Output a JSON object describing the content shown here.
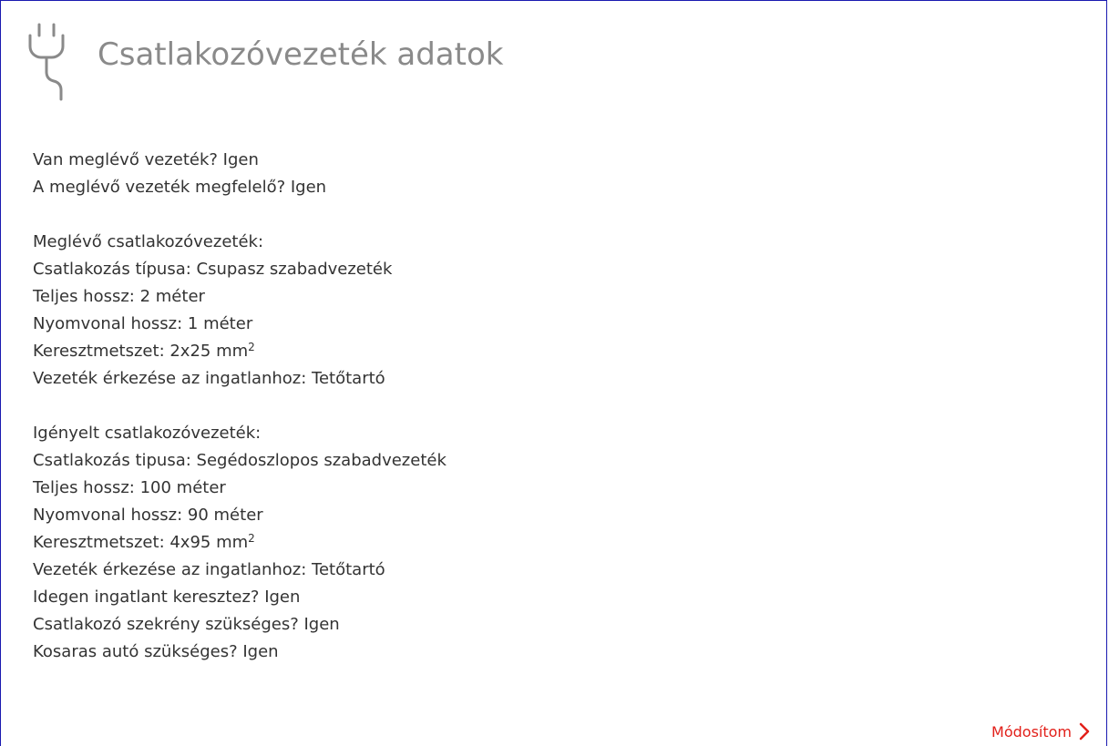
{
  "header": {
    "icon": "plug-icon",
    "title": "Csatlakozóvezeték adatok"
  },
  "summary": {
    "existing_line": "Van meglévő vezeték? Igen",
    "line_suitable": "A meglévő vezeték megfelelő? Igen"
  },
  "existing": {
    "heading": "Meglévő csatlakozóvezeték:",
    "type": "Csatlakozás típusa: Csupasz szabadvezeték",
    "length": "Teljes hossz: 2 méter",
    "route_length": "Nyomvonal hossz: 1 méter",
    "cross_section": "Keresztmetszet: 2x25 mm",
    "cross_section_unit_exp": "2",
    "arrival": "Vezeték érkezése az ingatlanhoz: Tetőtartó"
  },
  "requested": {
    "heading": "Igényelt csatlakozóvezeték:",
    "type": "Csatlakozás tipusa: Segédoszlopos szabadvezeték",
    "length": "Teljes hossz: 100 méter",
    "route_length": "Nyomvonal hossz: 90 méter",
    "cross_section": "Keresztmetszet: 4x95 mm",
    "cross_section_unit_exp": "2",
    "arrival": "Vezeték érkezése az ingatlanhoz: Tetőtartó",
    "foreign_property": "Idegen ingatlant keresztez? Igen",
    "cabinet_needed": "Csatlakozó szekrény szükséges? Igen",
    "bucket_truck_needed": "Kosaras autó szükséges? Igen"
  },
  "actions": {
    "modify_label": "Módosítom",
    "modify_icon": "chevron-right-icon",
    "accent_color": "#e2201a"
  }
}
